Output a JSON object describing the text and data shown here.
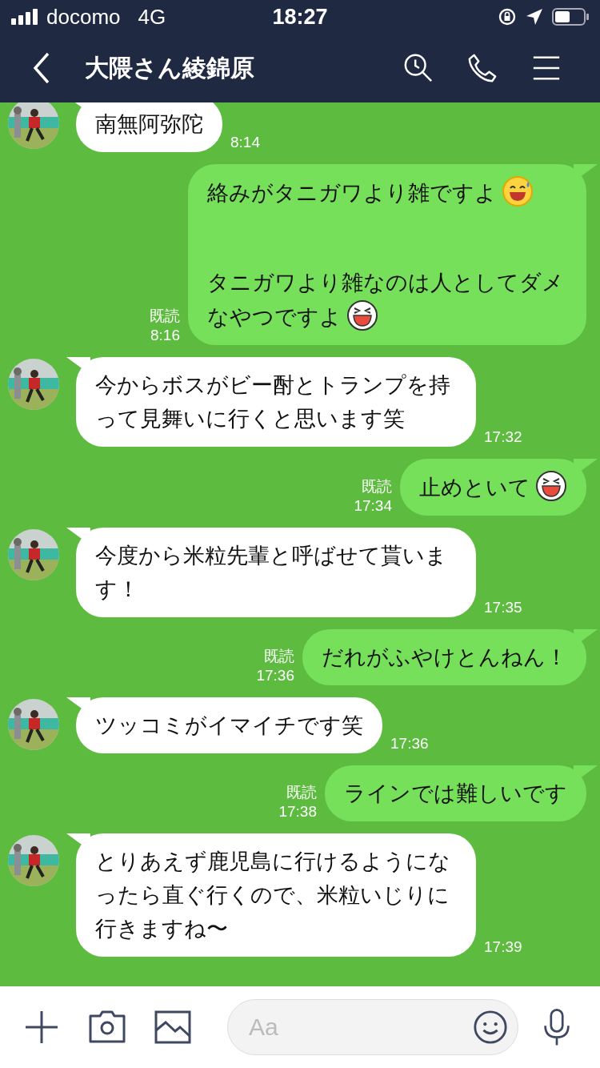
{
  "status_bar": {
    "carrier": "docomo",
    "network": "4G",
    "time": "18:27"
  },
  "header": {
    "title": "大隈さん綾錦原"
  },
  "messages": [
    {
      "kind": "incoming",
      "parts": [
        {
          "text": "南無阿弥陀"
        }
      ],
      "time": "8:14"
    },
    {
      "kind": "outgoing",
      "parts": [
        {
          "text": "絡みがタニガワより雑ですよ",
          "kind": "sweat"
        },
        {
          "text": "タニガワより雑なのは人としてダメなやつですよ",
          "kind": "laugh"
        }
      ],
      "read": "既読",
      "time": "8:16"
    },
    {
      "kind": "incoming",
      "parts": [
        {
          "text": "今からボスがビー酎とトランプを持って見舞いに行くと思います笑"
        }
      ],
      "time": "17:32"
    },
    {
      "kind": "outgoing",
      "parts": [
        {
          "text": "止めといて",
          "kind": "laugh"
        }
      ],
      "read": "既読",
      "time": "17:34"
    },
    {
      "kind": "incoming",
      "parts": [
        {
          "text": "今度から米粒先輩と呼ばせて貰います！"
        }
      ],
      "time": "17:35"
    },
    {
      "kind": "outgoing",
      "parts": [
        {
          "text": "だれがふやけとんねん！"
        }
      ],
      "read": "既読",
      "time": "17:36"
    },
    {
      "kind": "incoming",
      "parts": [
        {
          "text": "ツッコミがイマイチです笑"
        }
      ],
      "time": "17:36"
    },
    {
      "kind": "outgoing",
      "parts": [
        {
          "text": "ラインでは難しいです"
        }
      ],
      "read": "既読",
      "time": "17:38"
    },
    {
      "kind": "incoming",
      "parts": [
        {
          "text": "とりあえず鹿児島に行けるようになったら直ぐ行くので、米粒いじりに行きますね〜"
        }
      ],
      "time": "17:39"
    }
  ],
  "composer": {
    "placeholder": "Aa"
  }
}
